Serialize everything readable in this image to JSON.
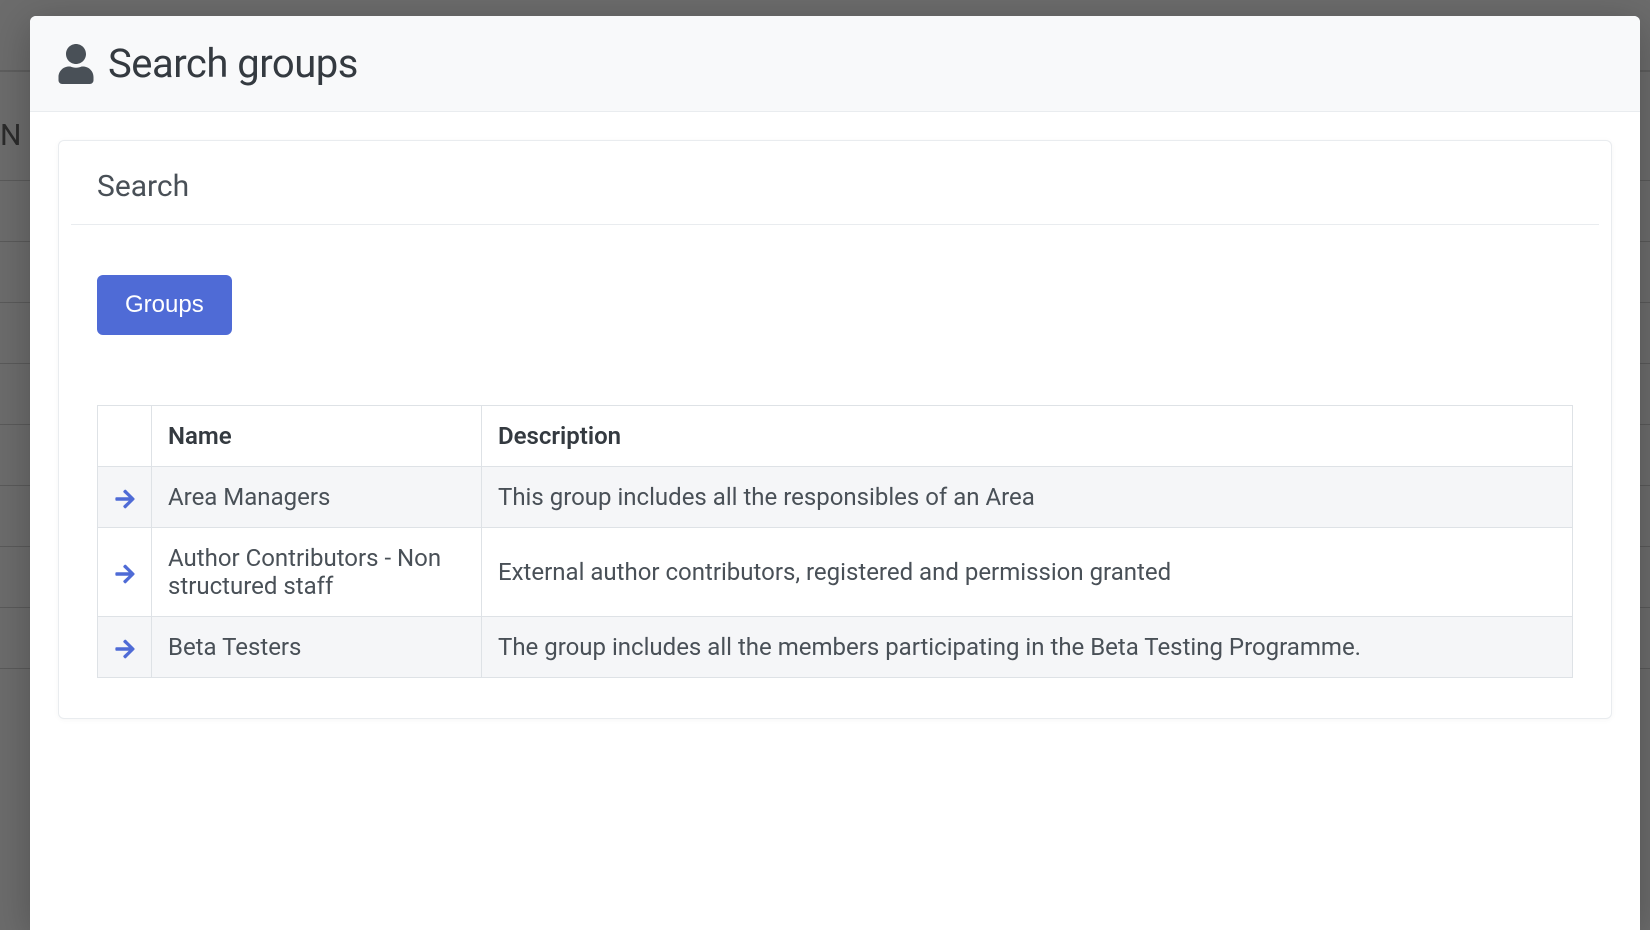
{
  "background": {
    "partial_text": "N"
  },
  "modal": {
    "title": "Search groups"
  },
  "card": {
    "title": "Search"
  },
  "tabs": {
    "groups": "Groups"
  },
  "table": {
    "headers": {
      "name": "Name",
      "description": "Description"
    },
    "rows": [
      {
        "name": "Area Managers",
        "description": "This group includes all the responsibles of an Area"
      },
      {
        "name": "Author Contributors - Non structured staff",
        "description": "External author contributors, registered and permission granted"
      },
      {
        "name": "Beta Testers",
        "description": "The group includes all the members participating in the Beta Testing Programme."
      }
    ]
  }
}
